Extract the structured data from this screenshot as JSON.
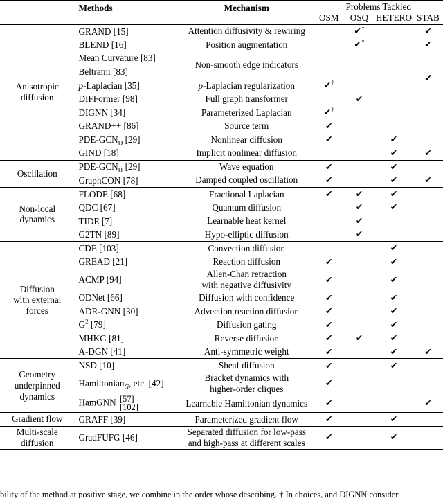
{
  "table": {
    "columns": {
      "category": "",
      "methods": "Methods",
      "mechanism": "Mechanism",
      "group_header": "Problems Tackled",
      "osm": "OSM",
      "osq": "OSQ",
      "hetero": "HETERO",
      "stab": "STAB"
    },
    "check_glyph": "✔",
    "sup_star": "*",
    "sup_dagger": "†",
    "sections": [
      {
        "category": "Anisotropic\ndiffusion",
        "category_line1": "Anisotropic",
        "category_line2": "diffusion",
        "rows": [
          {
            "method": "GRAND [15]",
            "mechanism": "Attention diffusivity & rewiring",
            "osm": "",
            "osq": "star",
            "hetero": "",
            "stab": "check"
          },
          {
            "method": "BLEND [16]",
            "mechanism": "Position augmentation",
            "osm": "",
            "osq": "star",
            "hetero": "",
            "stab": "check"
          },
          {
            "method": "Mean Curvature [83]",
            "mechanism": "Non-smooth edge indicators",
            "mechanism_span": 2,
            "osm": "",
            "osq": "",
            "hetero": "",
            "stab": ""
          },
          {
            "method": "Beltrami [83]",
            "mechanism": "",
            "osm": "",
            "osq": "",
            "hetero": "",
            "stab": "check",
            "stab_span": 2
          },
          {
            "method": "p-Laplacian [35]",
            "mechanism": "p-Laplacian regularization",
            "osm": "dagger",
            "osq": "",
            "hetero": "",
            "stab": ""
          },
          {
            "method": "DIFFormer [98]",
            "mechanism": "Full graph transformer",
            "osm": "",
            "osq": "check",
            "hetero": "",
            "stab": ""
          },
          {
            "method": "DIGNN [34]",
            "mechanism": "Parameterized Laplacian",
            "osm": "dagger",
            "osq": "",
            "hetero": "",
            "stab": ""
          },
          {
            "method": "GRAND++ [86]",
            "mechanism": "Source term",
            "osm": "check",
            "osq": "",
            "hetero": "",
            "stab": ""
          },
          {
            "method": "PDE-GCN_D [29]",
            "mechanism": "Nonlinear diffusion",
            "osm": "check",
            "osq": "",
            "hetero": "check",
            "stab": ""
          },
          {
            "method": "GIND [18]",
            "mechanism": "Implicit nonlinear diffusion",
            "osm": "",
            "osq": "",
            "hetero": "check",
            "stab": "check"
          }
        ]
      },
      {
        "category": "Oscillation",
        "category_line1": "Oscillation",
        "category_line2": "",
        "rows": [
          {
            "method": "PDE-GCN_H [29]",
            "mechanism": "Wave equation",
            "osm": "check",
            "osq": "",
            "hetero": "check",
            "stab": ""
          },
          {
            "method": "GraphCON [78]",
            "mechanism": "Damped coupled oscillation",
            "osm": "check",
            "osq": "",
            "hetero": "check",
            "stab": "check"
          }
        ]
      },
      {
        "category": "Non-local\ndynamics",
        "category_line1": "Non-local",
        "category_line2": "dynamics",
        "rows": [
          {
            "method": "FLODE [68]",
            "mechanism": "Fractional Laplacian",
            "osm": "check",
            "osq": "check",
            "hetero": "check",
            "stab": ""
          },
          {
            "method": "QDC [67]",
            "mechanism": "Quantum diffusion",
            "osm": "",
            "osq": "check",
            "hetero": "check",
            "stab": ""
          },
          {
            "method": "TIDE [7]",
            "mechanism": "Learnable heat kernel",
            "osm": "",
            "osq": "check",
            "hetero": "",
            "stab": ""
          },
          {
            "method": "G2TN [89]",
            "mechanism": "Hypo-elliptic diffusion",
            "osm": "",
            "osq": "check",
            "hetero": "",
            "stab": ""
          }
        ]
      },
      {
        "category": "Diffusion\nwith external\nforces",
        "category_line1": "Diffusion",
        "category_line2": "with external",
        "category_line3": "forces",
        "rows": [
          {
            "method": "CDE [103]",
            "mechanism": "Convection diffusion",
            "osm": "",
            "osq": "",
            "hetero": "check",
            "stab": ""
          },
          {
            "method": "GREAD [21]",
            "mechanism": "Reaction diffusion",
            "osm": "check",
            "osq": "",
            "hetero": "check",
            "stab": ""
          },
          {
            "method": "ACMP [94]",
            "mechanism": "Allen-Chan retraction\nwith negative diffusivity",
            "mechanism_line1": "Allen-Chan retraction",
            "mechanism_line2": "with negative diffusivity",
            "osm": "check",
            "osq": "",
            "hetero": "check",
            "stab": ""
          },
          {
            "method": "ODNet [66]",
            "mechanism": "Diffusion with confidence",
            "osm": "check",
            "osq": "",
            "hetero": "check",
            "stab": ""
          },
          {
            "method": "ADR-GNN [30]",
            "mechanism": "Advection reaction diffusion",
            "osm": "check",
            "osq": "",
            "hetero": "check",
            "stab": ""
          },
          {
            "method": "G^2 [79]",
            "mechanism": "Diffusion gating",
            "osm": "check",
            "osq": "",
            "hetero": "check",
            "stab": ""
          },
          {
            "method": "MHKG [81]",
            "mechanism": "Reverse diffusion",
            "osm": "check",
            "osq": "check",
            "hetero": "check",
            "stab": ""
          },
          {
            "method": "A-DGN [41]",
            "mechanism": "Anti-symmetric weight",
            "osm": "check",
            "osq": "",
            "hetero": "check",
            "stab": "check"
          }
        ]
      },
      {
        "category": "Geometry\nunderpinned\ndynamics",
        "category_line1": "Geometry",
        "category_line2": "underpinned",
        "category_line3": "dynamics",
        "rows": [
          {
            "method": "NSD [10]",
            "mechanism": "Sheaf diffusion",
            "osm": "check",
            "osq": "",
            "hetero": "check",
            "stab": ""
          },
          {
            "method": "Hamiltonian_G, etc. [42]",
            "mechanism": "Bracket dynamics with\nhigher-order cliques",
            "mechanism_line1": "Bracket dynamics with",
            "mechanism_line2": "higher-order cliques",
            "osm": "check",
            "osq": "",
            "hetero": "",
            "stab": ""
          },
          {
            "method": "HamGNN [57] [102]",
            "method_base": "HamGNN",
            "method_ref1": "[57]",
            "method_ref2": "[102]",
            "mechanism": "Learnable Hamiltonian dynamics",
            "osm": "check",
            "osq": "",
            "hetero": "",
            "stab": "check"
          }
        ]
      },
      {
        "category": "Gradient flow",
        "category_line1": "Gradient flow",
        "category_line2": "",
        "rows": [
          {
            "method": "GRAFF [39]",
            "mechanism": "Parameterized gradient flow",
            "osm": "check",
            "osq": "",
            "hetero": "check",
            "stab": ""
          }
        ]
      },
      {
        "category": "Multi-scale\ndiffusion",
        "category_line1": "Multi-scale",
        "category_line2": "diffusion",
        "rows": [
          {
            "method": "GradFUFG [46]",
            "mechanism": "Separated diffusion for low-pass\nand high-pass at different scales",
            "mechanism_line1": "Separated diffusion for low-pass",
            "mechanism_line2": "and high-pass at different scales",
            "osm": "check",
            "osq": "",
            "hetero": "check",
            "stab": ""
          }
        ]
      }
    ]
  },
  "caption": {
    "partial_text": "bility of the method at positive stage, we combine in the order whose describing. † In choices, and DIGNN consider"
  }
}
